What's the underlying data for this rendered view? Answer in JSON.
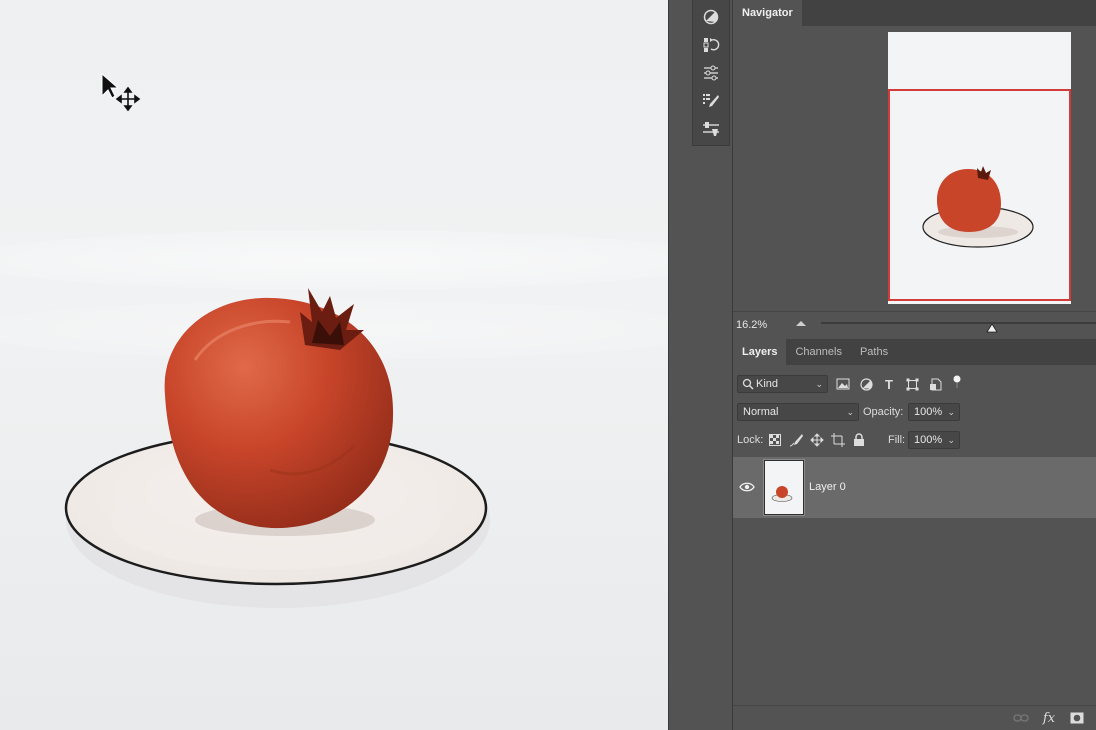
{
  "panels": {
    "navigator": {
      "tab_label": "Navigator",
      "zoom": "16.2%",
      "zoom_level": 0.62
    },
    "layers": {
      "tabs": [
        "Layers",
        "Channels",
        "Paths"
      ],
      "active_tab": "Layers",
      "filter": {
        "kind_label": "Kind"
      },
      "blend_mode": "Normal",
      "opacity_label": "Opacity:",
      "opacity_value": "100%",
      "lock_label": "Lock:",
      "fill_label": "Fill:",
      "fill_value": "100%",
      "layers": [
        {
          "name": "Layer 0",
          "visible": true
        }
      ]
    },
    "footer": {
      "fx_label": "fx"
    }
  },
  "colors": {
    "panel": "#535353",
    "tab_bar": "#424242",
    "selected_row": "#6a6a6a",
    "nav_frame": "#d33a3a",
    "fruit": "#c8452a"
  },
  "icons": [
    "move-cursor-icon",
    "adjustments-icon",
    "history-icon",
    "properties-icon",
    "brush-settings-icon",
    "tool-presets-icon",
    "search-icon",
    "image-filter-icon",
    "adjustment-filter-icon",
    "type-filter-icon",
    "shape-filter-icon",
    "smart-object-filter-icon",
    "filter-toggle-icon",
    "lock-transparent-icon",
    "lock-pixels-icon",
    "lock-position-icon",
    "lock-artboard-icon",
    "lock-all-icon",
    "eye-icon",
    "link-icon",
    "fx-icon",
    "mask-icon"
  ]
}
